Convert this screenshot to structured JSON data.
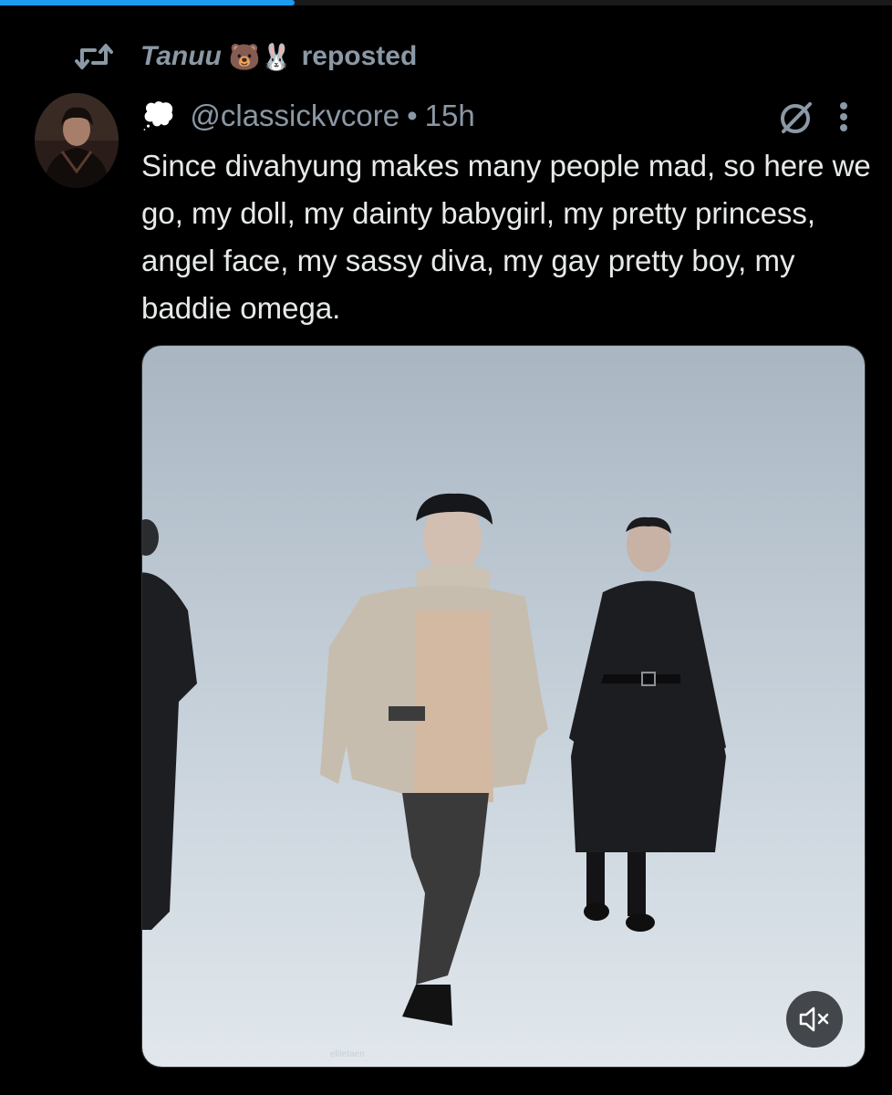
{
  "progress": {
    "fraction": 0.33,
    "color": "#1d9bf0"
  },
  "repost": {
    "icon": "repost-icon",
    "name": "Tanuu",
    "emoji": "🐻🐰",
    "label": "reposted"
  },
  "tweet": {
    "header_icon": "thought-cloud-icon",
    "header_emoji": "💭",
    "handle": "@classickvcore",
    "separator": "•",
    "time": "15h",
    "text": "Since divahyung makes many people mad, so here we go, my doll, my dainty babygirl, my pretty princess, angel face, my sassy diva, my gay pretty boy, my baddie omega."
  },
  "actions": {
    "hide_icon": "hide-reply-icon",
    "more_icon": "more-options-icon"
  },
  "media": {
    "type": "video",
    "watermark": "elitetaen",
    "mute_icon": "volume-muted-icon"
  },
  "colors": {
    "background": "#000000",
    "text": "#e7e9ea",
    "muted": "#8b98a5",
    "accent": "#1d9bf0"
  }
}
